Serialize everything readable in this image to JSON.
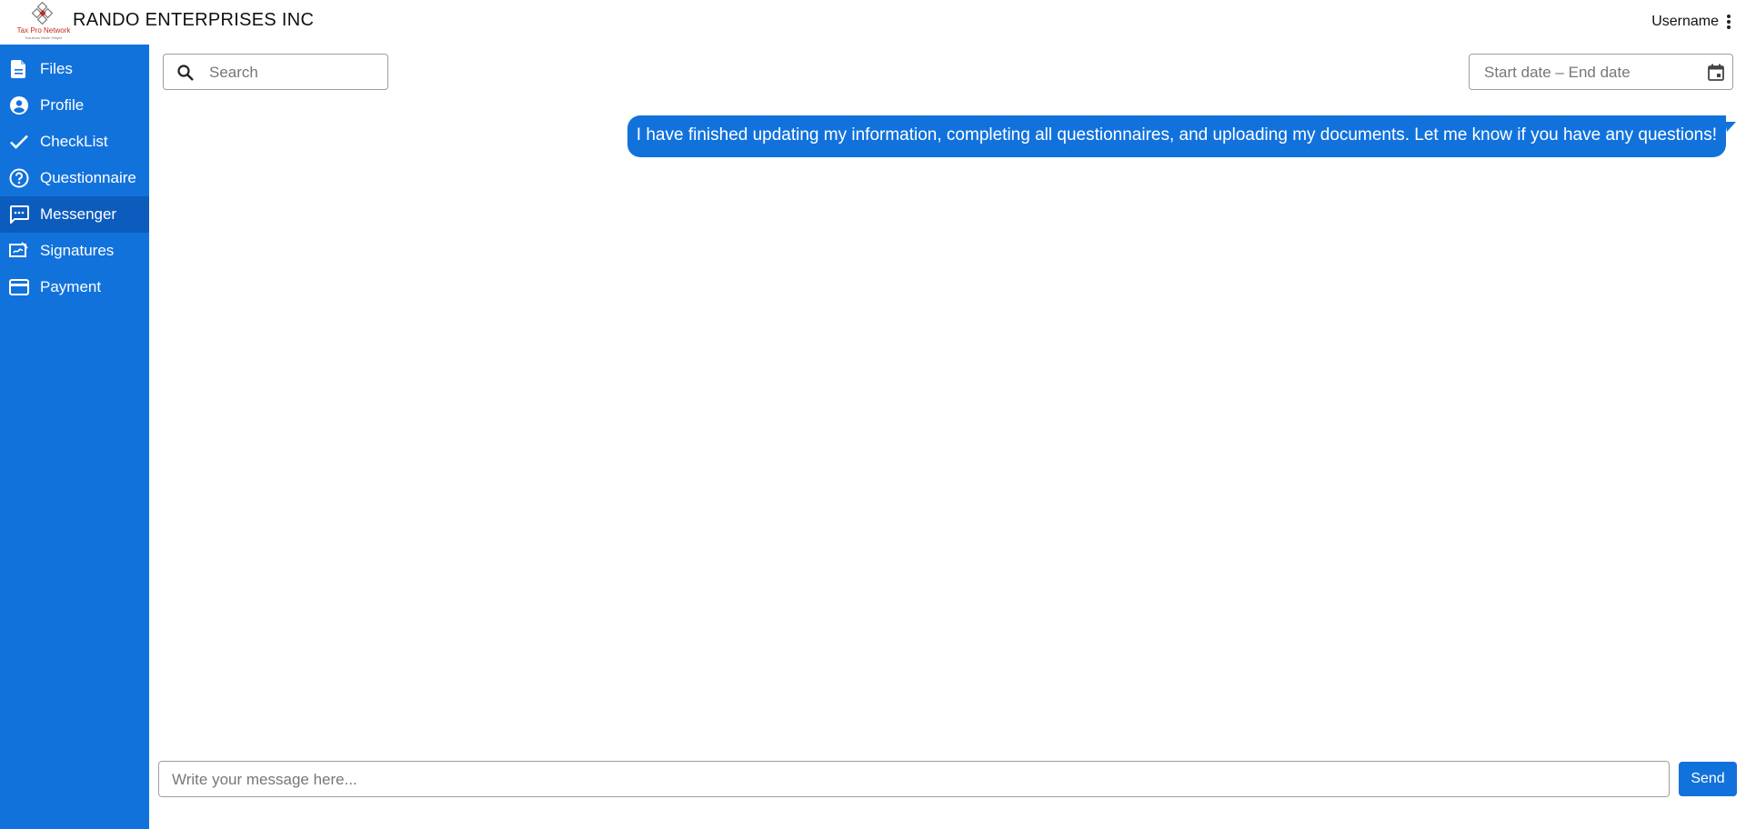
{
  "header": {
    "logo": {
      "name": "Tax Pro Network",
      "tagline": "Solutions Made Simple"
    },
    "company": "RANDO ENTERPRISES INC",
    "username": "Username",
    "menu_icon": "more-vert-icon"
  },
  "sidebar": {
    "items": [
      {
        "label": "Files",
        "icon": "file-icon",
        "active": false
      },
      {
        "label": "Profile",
        "icon": "account-circle-icon",
        "active": false
      },
      {
        "label": "CheckList",
        "icon": "check-icon",
        "active": false
      },
      {
        "label": "Questionnaire",
        "icon": "help-circle-icon",
        "active": false
      },
      {
        "label": "Messenger",
        "icon": "chat-icon",
        "active": true
      },
      {
        "label": "Signatures",
        "icon": "signature-icon",
        "active": false
      },
      {
        "label": "Payment",
        "icon": "credit-card-icon",
        "active": false
      }
    ]
  },
  "toolbar": {
    "search_placeholder": "Search",
    "date_range_placeholder": "Start date – End date"
  },
  "messages": [
    {
      "text": "I have finished updating my information, completing all questionnaires, and uploading my documents. Let me know if you have any questions!",
      "sender": "self"
    }
  ],
  "composer": {
    "placeholder": "Write your message here...",
    "send_label": "Send"
  },
  "colors": {
    "primary": "#1272dc",
    "sidebar_active": "#0c5cbd",
    "logo_red": "#c62828"
  }
}
